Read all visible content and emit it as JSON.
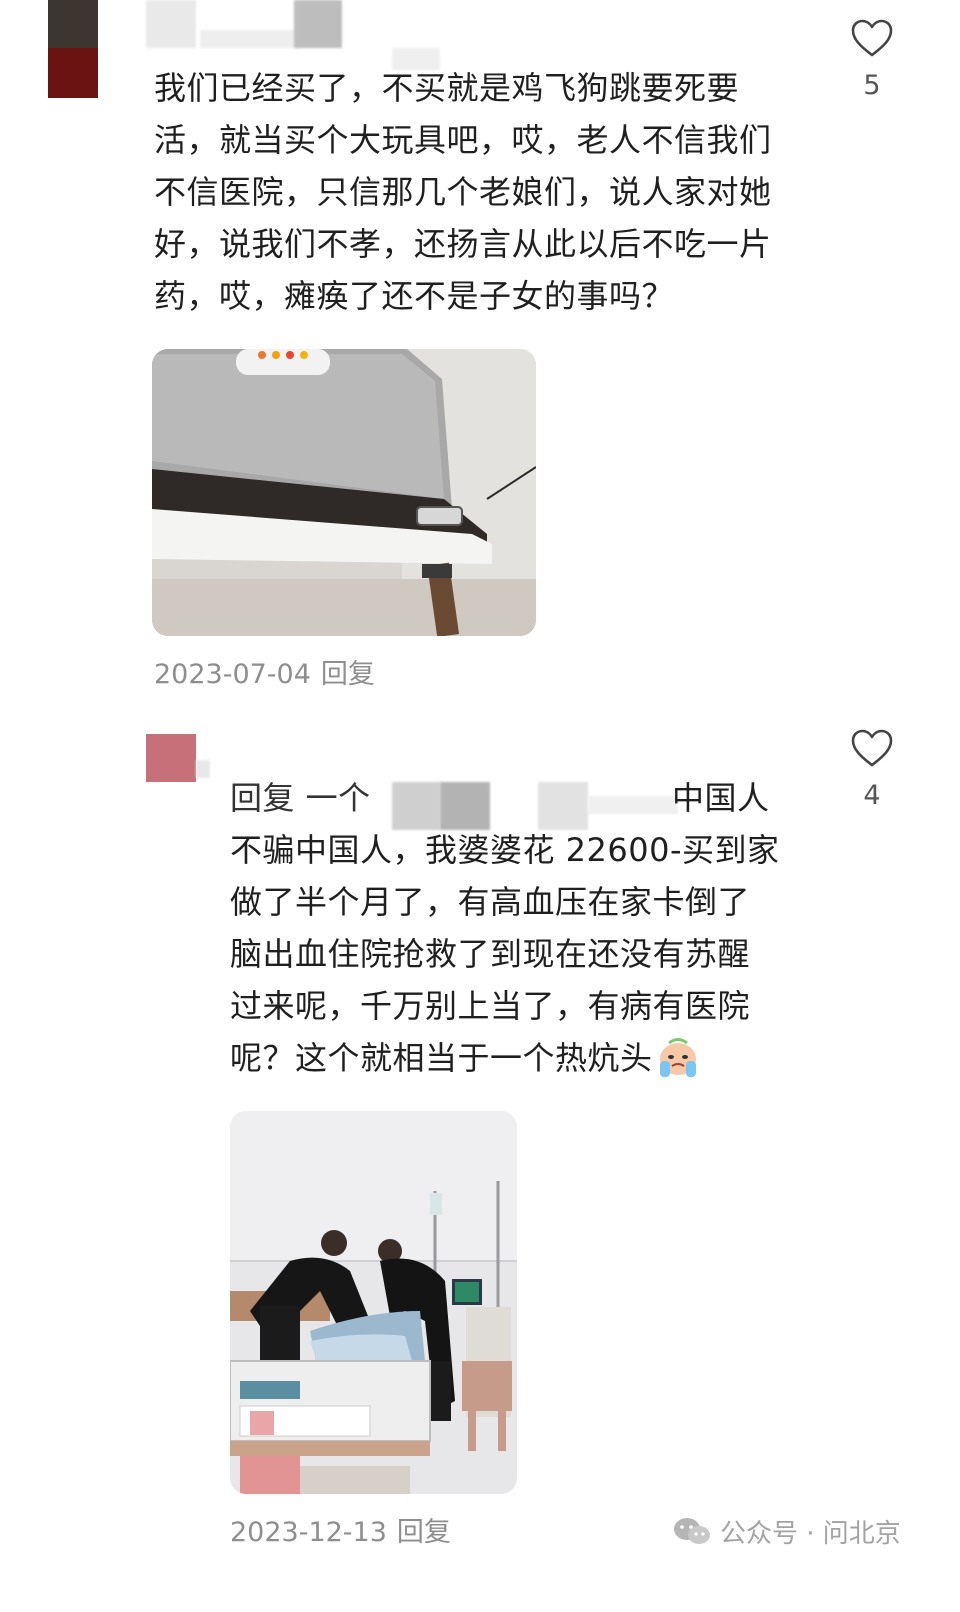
{
  "comments": [
    {
      "text": "我们已经买了，不买就是鸡飞狗跳要死要活，就当买个大玩具吧，哎，老人不信我们不信医院，只信那几个老娘们，说人家对她好，说我们不孝，还扬言从此以后不吃一片药，哎，瘫痪了还不是子女的事吗？",
      "lines": [
        "我们已经买了，不买就是鸡飞狗跳要死要",
        "活，就当买个大玩具吧，哎，老人不信我们",
        "不信医院，只信那几个老娘们，说人家对她",
        "好，说我们不孝，还扬言从此以后不吃一片",
        "药，哎，瘫痪了还不是子女的事吗？"
      ],
      "date": "2023-07-04",
      "reply_label": "回复",
      "likes": "5"
    },
    {
      "lines": [
        "回复 一个",
        "中国人",
        "不骗中国人，我婆婆花 22600-买到家",
        "做了半个月了，有高血压在家卡倒了",
        "脑出血住院抢救了到现在还没有苏醒",
        "过来呢，千万别上当了，有病有医院",
        "呢？这个就相当于一个热炕头"
      ],
      "date": "2023-12-13",
      "reply_label": "回复",
      "likes": "4"
    }
  ],
  "watermark": {
    "text": "公众号 · 问北京"
  },
  "icons": {
    "like": "heart-outline-icon",
    "emoji": "crying-face-emoji-icon",
    "watermark": "wechat-icon"
  },
  "colors": {
    "text": "#1f1f1f",
    "meta": "#8e8e8e",
    "heart": "#444444",
    "avatar1_top": "#3d3530",
    "avatar1_bottom": "#6b1212",
    "avatar2": "#c7707a"
  }
}
